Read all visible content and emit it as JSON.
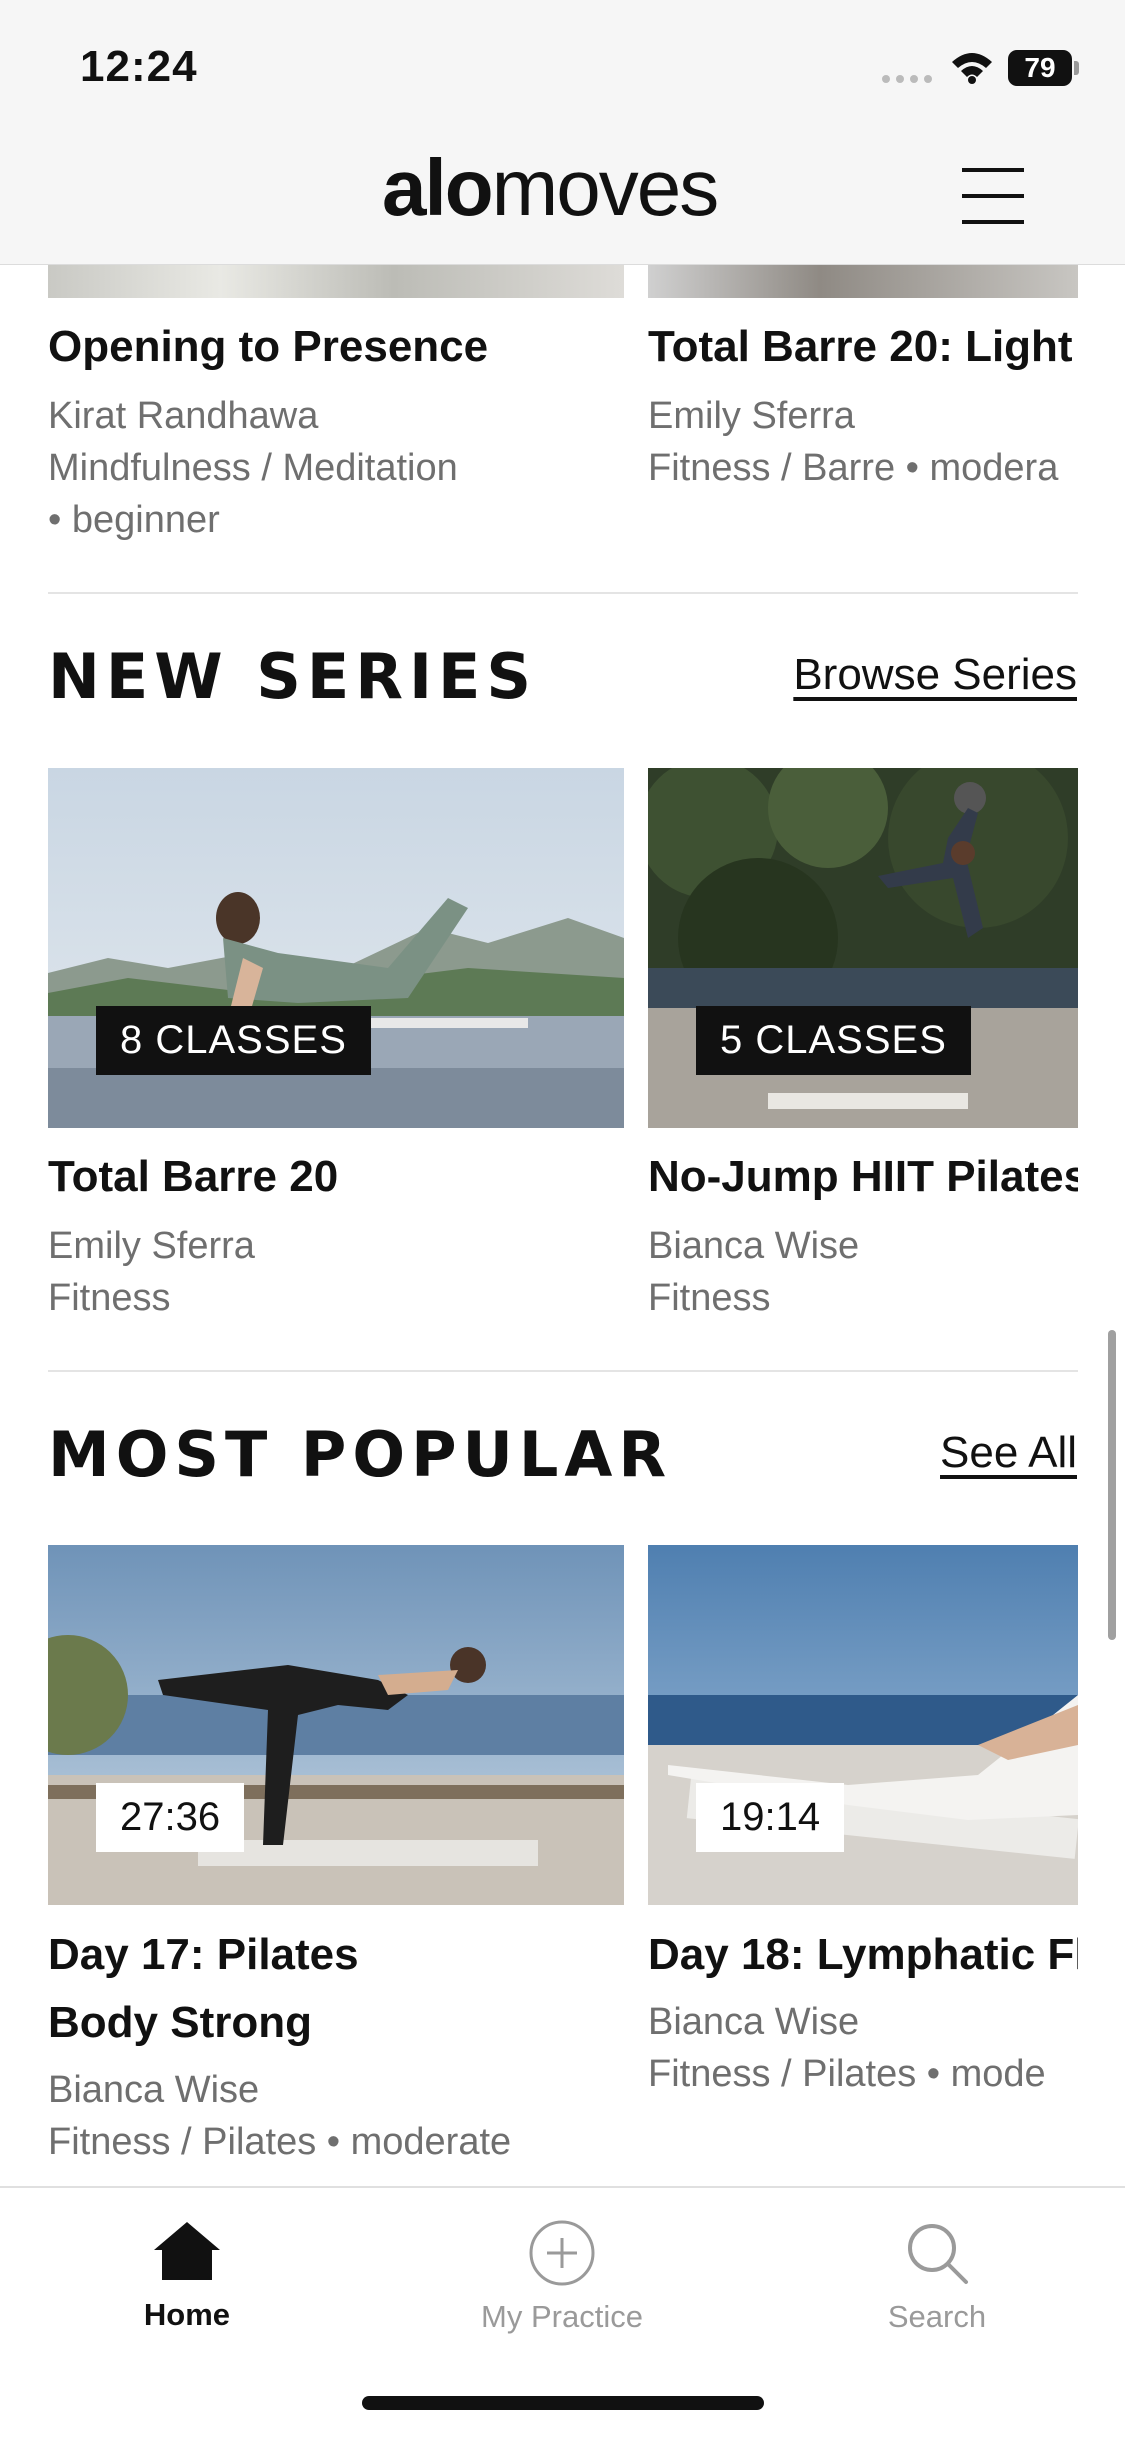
{
  "status_bar": {
    "time": "12:24",
    "battery": "79"
  },
  "header": {
    "logo_bold": "alo",
    "logo_light": "moves",
    "menu_icon": "hamburger-menu-icon"
  },
  "top_row": [
    {
      "title": "Opening to Presence",
      "instructor": "Kirat Randhawa",
      "meta_line1": "Mindfulness / Meditation",
      "meta_line2": "• beginner"
    },
    {
      "title": "Total Barre 20: Light",
      "instructor": "Emily Sferra",
      "meta_line1": "Fitness / Barre • modera"
    }
  ],
  "new_series": {
    "title": "NEW SERIES",
    "link": "Browse Series",
    "cards": [
      {
        "badge": "8 CLASSES",
        "title": "Total Barre 20",
        "instructor": "Emily Sferra",
        "category": "Fitness"
      },
      {
        "badge": "5 CLASSES",
        "title": "No-Jump HIIT Pilates",
        "instructor": "Bianca Wise",
        "category": "Fitness"
      }
    ]
  },
  "most_popular": {
    "title": "MOST POPULAR",
    "link": "See All",
    "cards": [
      {
        "duration": "27:36",
        "title_line1": "Day 17: Pilates",
        "title_line2": "Body Strong",
        "instructor": "Bianca Wise",
        "meta": "Fitness / Pilates • moderate"
      },
      {
        "duration": "19:14",
        "title_line1": "Day 18: Lymphatic Fl",
        "instructor": "Bianca Wise",
        "meta": "Fitness / Pilates • mode"
      }
    ]
  },
  "tabs": [
    {
      "label": "Home",
      "icon": "home-icon",
      "active": true
    },
    {
      "label": "My Practice",
      "icon": "plus-circle-icon",
      "active": false
    },
    {
      "label": "Search",
      "icon": "search-icon",
      "active": false
    }
  ],
  "colors": {
    "active_tab": "#111111",
    "inactive_tab": "#9a9a9a",
    "subtext": "#6f6f6f"
  }
}
